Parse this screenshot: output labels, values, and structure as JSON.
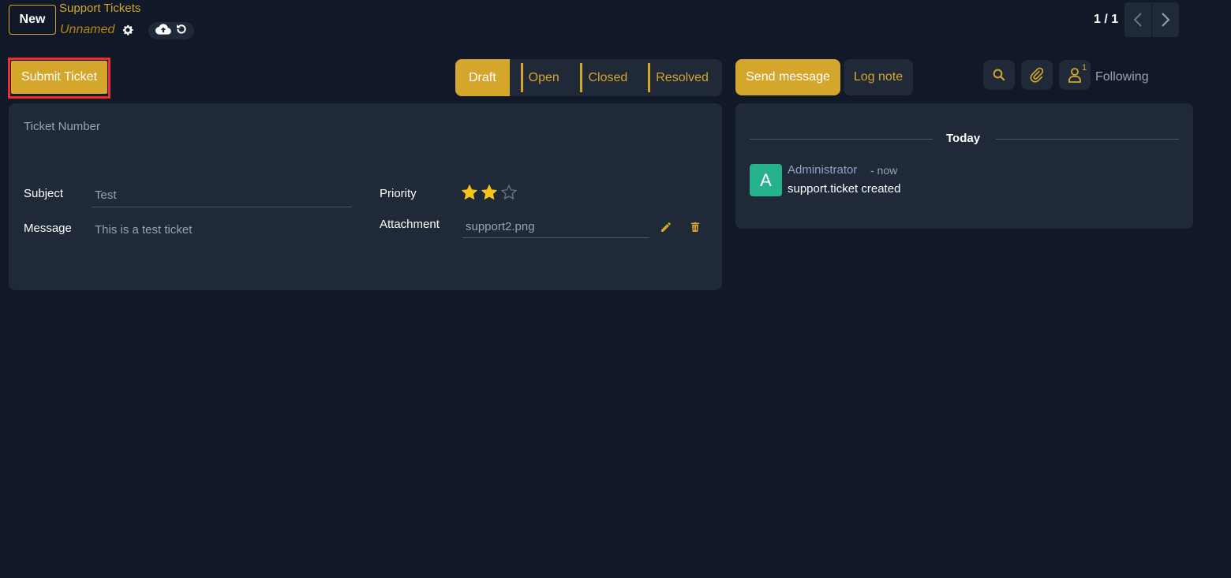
{
  "top": {
    "new_label": "New",
    "breadcrumb": "Support Tickets",
    "record_name": "Unnamed",
    "pager": "1 / 1"
  },
  "actions": {
    "submit_label": "Submit Ticket"
  },
  "statusbar": {
    "stages": [
      {
        "label": "Draft",
        "active": true
      },
      {
        "label": "Open",
        "active": false
      },
      {
        "label": "Closed",
        "active": false
      },
      {
        "label": "Resolved",
        "active": false
      }
    ]
  },
  "form": {
    "ticket_number_label": "Ticket Number",
    "subject_label": "Subject",
    "subject_value": "Test",
    "message_label": "Message",
    "message_value": "This is a test ticket",
    "priority_label": "Priority",
    "priority_value": 2,
    "priority_max": 3,
    "attachment_label": "Attachment",
    "attachment_value": "support2.png"
  },
  "chatter": {
    "send_label": "Send message",
    "log_label": "Log note",
    "follower_count": "1",
    "following_label": "Following",
    "date_separator": "Today",
    "messages": [
      {
        "avatar": "A",
        "author": "Administrator",
        "time": "- now",
        "body": "support.ticket created"
      }
    ]
  },
  "icons": {
    "gear": "gear-icon",
    "upload": "cloud-upload-icon",
    "discard": "undo-icon",
    "prev": "chevron-left-icon",
    "next": "chevron-right-icon",
    "search": "search-icon",
    "attach": "paperclip-icon",
    "followers": "user-icon",
    "edit": "pencil-icon",
    "delete": "trash-icon",
    "star": "star-icon"
  },
  "colors": {
    "accent": "#d4a72c",
    "background": "#111827",
    "card": "#1f2937",
    "avatar": "#27b28e",
    "annotation": "#ef2b2b"
  }
}
